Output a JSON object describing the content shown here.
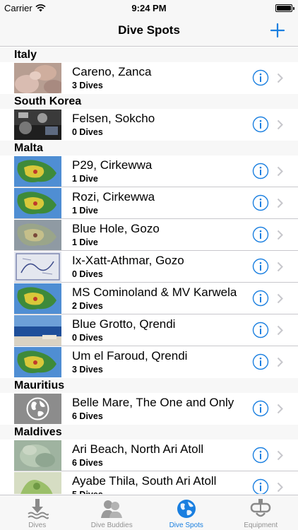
{
  "status_bar": {
    "carrier": "Carrier",
    "time": "9:24 PM"
  },
  "nav": {
    "title": "Dive Spots",
    "add_icon": "plus-icon"
  },
  "colors": {
    "accent": "#1a7fe0",
    "separator": "#c8c7cc",
    "bar_bg": "#f7f7f7"
  },
  "sections": [
    {
      "title": "Italy",
      "spots": [
        {
          "name": "Careno, Zanca",
          "dives": "3 Dives",
          "thumb": "photo-hands"
        }
      ]
    },
    {
      "title": "South Korea",
      "spots": [
        {
          "name": "Felsen, Sokcho",
          "dives": "0 Dives",
          "thumb": "photo-gear"
        }
      ]
    },
    {
      "title": "Malta",
      "spots": [
        {
          "name": "P29, Cirkewwa",
          "dives": "1 Dive",
          "thumb": "map"
        },
        {
          "name": "Rozi, Cirkewwa",
          "dives": "1 Dive",
          "thumb": "map"
        },
        {
          "name": "Blue Hole, Gozo",
          "dives": "1 Dive",
          "thumb": "map-gray"
        },
        {
          "name": "Ix-Xatt-Athmar, Gozo",
          "dives": "0 Dives",
          "thumb": "sketch"
        },
        {
          "name": "MS Cominoland & MV Karwela",
          "dives": "2 Dives",
          "thumb": "map"
        },
        {
          "name": "Blue Grotto, Qrendi",
          "dives": "0 Dives",
          "thumb": "sea"
        },
        {
          "name": "Um el Faroud, Qrendi",
          "dives": "3 Dives",
          "thumb": "map"
        }
      ]
    },
    {
      "title": "Mauritius",
      "spots": [
        {
          "name": "Belle Mare, The One and Only",
          "dives": "6 Dives",
          "thumb": "globe"
        }
      ]
    },
    {
      "title": "Maldives",
      "spots": [
        {
          "name": "Ari Beach, North Ari Atoll",
          "dives": "6 Dives",
          "thumb": "blur-green"
        },
        {
          "name": "Ayabe Thila, South Ari Atoll",
          "dives": "5 Dives",
          "thumb": "sketch-green"
        }
      ]
    }
  ],
  "tabs": [
    {
      "label": "Dives",
      "icon": "dive-download-icon",
      "active": false
    },
    {
      "label": "Dive Buddies",
      "icon": "buddies-icon",
      "active": false
    },
    {
      "label": "Dive Spots",
      "icon": "globe-icon",
      "active": true
    },
    {
      "label": "Equipment",
      "icon": "mask-icon",
      "active": false
    }
  ]
}
